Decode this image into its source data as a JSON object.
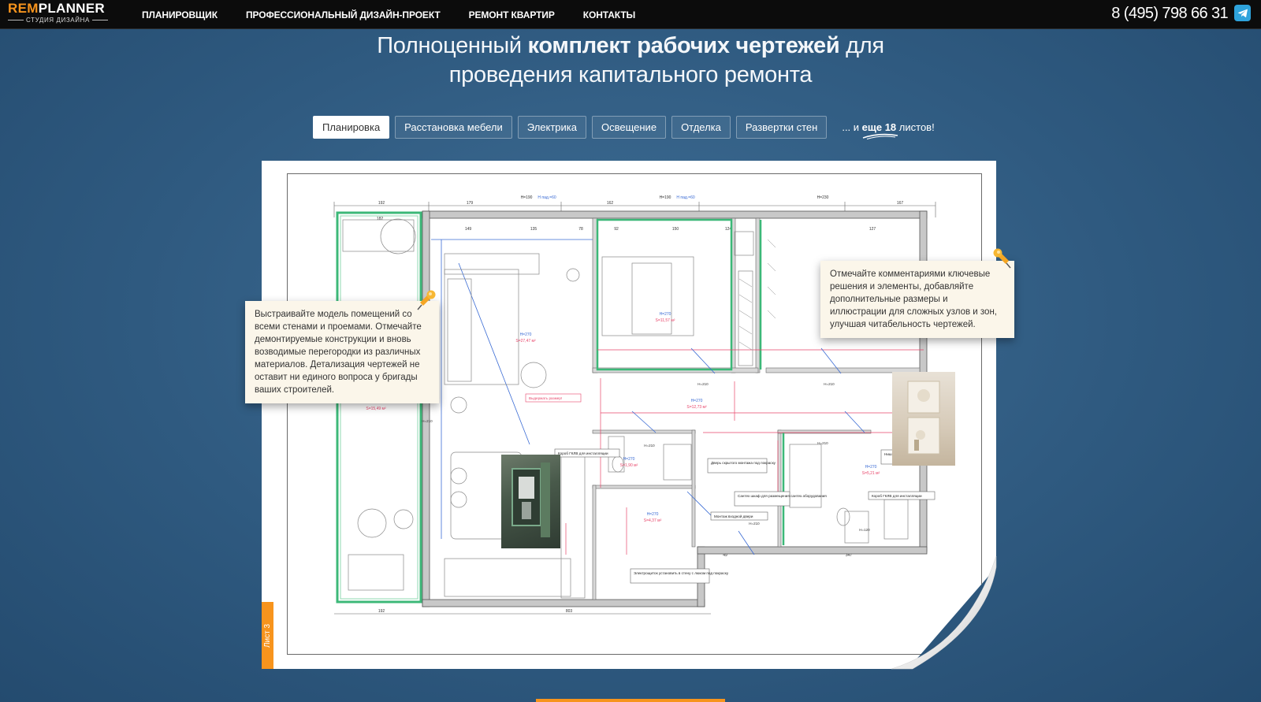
{
  "logo": {
    "brand_a": "REM",
    "brand_b": "PLANNER",
    "tagline": "СТУДИЯ ДИЗАЙНА"
  },
  "nav": [
    {
      "label": "ПЛАНИРОВЩИК"
    },
    {
      "label": "ПРОФЕССИОНАЛЬНЫЙ ДИЗАЙН-ПРОЕКТ"
    },
    {
      "label": "РЕМОНТ КВАРТИР"
    },
    {
      "label": "КОНТАКТЫ"
    }
  ],
  "contact": {
    "phone": "8 (495) 798 66 31",
    "messenger_icon": "telegram-icon"
  },
  "headline": {
    "pre": "Полноценный ",
    "bold": "комплект рабочих чертежей",
    "post": " для",
    "line2": "проведения капитального ремонта"
  },
  "tabs": [
    {
      "label": "Планировка",
      "active": true
    },
    {
      "label": "Расстановка мебели",
      "active": false
    },
    {
      "label": "Электрика",
      "active": false
    },
    {
      "label": "Освещение",
      "active": false
    },
    {
      "label": "Отделка",
      "active": false
    },
    {
      "label": "Развертки стен",
      "active": false
    }
  ],
  "more": {
    "pre": "... и ",
    "bold": "еще 18",
    "post": " листов!"
  },
  "sheet": {
    "label": "Лист 3"
  },
  "notes": {
    "left": "Выстраивайте модель помещений со всеми стенами и проемами. Отмечайте демонтируемые конструкции и вновь возводимые перегородки из различных материалов. Детализация чертежей не оставит ни единого вопроса у бригады ваших строителей.",
    "right": "Отмечайте комментариями ключевые решения и элементы, добавляйте дополнительные размеры и иллюстрации для сложных узлов и зон, улучшая читабельность чертежей."
  },
  "plan_labels": {
    "dims_top": [
      "192",
      "179",
      "H=190",
      "H пад.=60",
      "162",
      "H=190",
      "H пад.=60",
      "H=230",
      "167"
    ],
    "dims_inner": [
      "182",
      "149",
      "135",
      "78",
      "92",
      "150",
      "124",
      "127"
    ],
    "dims_bottom": [
      "192",
      "803",
      "49",
      "347"
    ],
    "rooms": [
      {
        "h": "H=270",
        "s": "S=27,47 м²"
      },
      {
        "h": "H=270",
        "s": "S=11,57 м²"
      },
      {
        "h": "H=270",
        "s": "S=15,49 м²"
      },
      {
        "h": "H=270",
        "s": "S=12,73 м²"
      },
      {
        "h": "H=270",
        "s": "S=1,90 м²"
      },
      {
        "h": "H=270",
        "s": "S=4,37 м²"
      },
      {
        "h": "H=270",
        "s": "S=5,21 м²"
      }
    ],
    "door_heights": [
      "H=210",
      "H=210",
      "H=210",
      "H=210",
      "H=210",
      "H=210",
      "H=120"
    ],
    "callouts": [
      "Выдержать размер!",
      "Короб ГКЛВ для инсталляции",
      "Дверь скрытого монтажа под покраску",
      "Сантех шкаф для размещения сантех.оборудования",
      "Монтаж входной двери",
      "Электрощиток установить в стену с люком под покраску",
      "Ниши из плитки для аксессуаров",
      "Короб ГКЛВ для инсталляции"
    ]
  }
}
